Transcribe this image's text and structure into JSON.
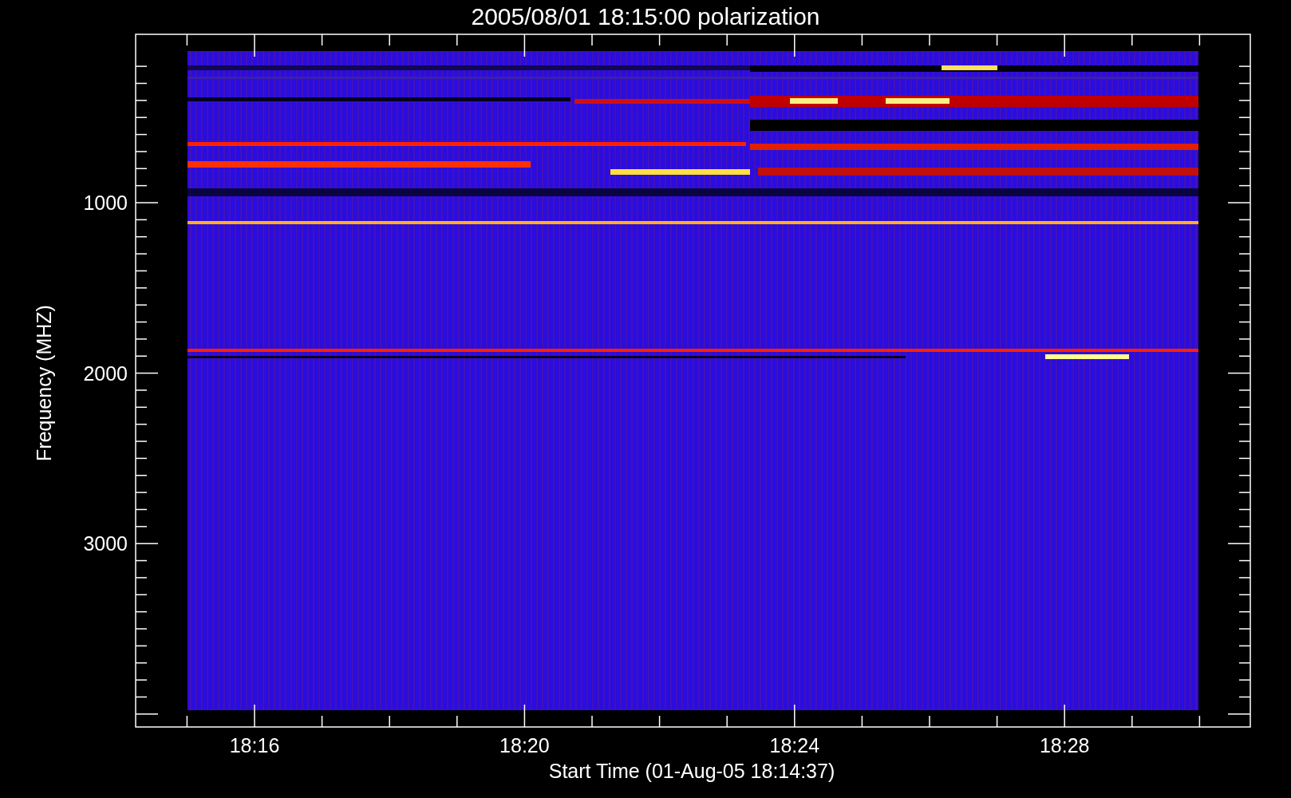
{
  "title": "2005/08/01 18:15:00 polarization",
  "y_axis": {
    "label": "Frequency (MHZ)",
    "ticks": [
      "1000",
      "2000",
      "3000"
    ]
  },
  "x_axis": {
    "label": "Start Time (01-Aug-05 18:14:37)",
    "ticks": [
      "18:16",
      "18:20",
      "18:24",
      "18:28"
    ]
  }
}
